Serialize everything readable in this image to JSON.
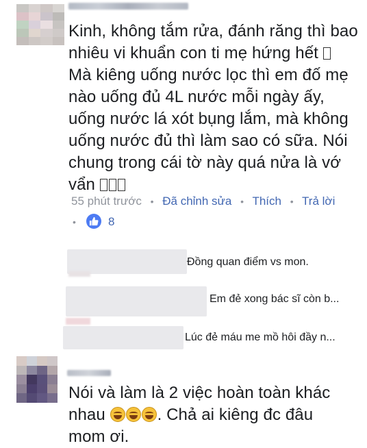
{
  "comment1": {
    "lines": [
      "Kinh, không tắm rửa, đánh răng thì bao",
      "nhiêu vi khuẩn con ti mẹ hứng hết",
      "Mà kiêng uống nước lọc thì em đố mẹ",
      "nào uống đủ 4L nước mỗi ngày ấy,",
      "uống nước lá xót bụng lắm, mà không",
      "uống nước đủ thì làm sao có sữa. Nói",
      "chung trong cái tờ này quá nửa là vớ",
      "vẩn"
    ],
    "time": "55 phút trước",
    "edited": "Đã chỉnh sửa",
    "like": "Thích",
    "reply": "Trả lời",
    "like_count": "8"
  },
  "replies": [
    {
      "text": "Đồng quan điểm vs mon."
    },
    {
      "text": "Em đẻ xong bác sĩ còn b..."
    },
    {
      "text": "Lúc đẻ máu me mồ hôi đầy n..."
    }
  ],
  "comment2": {
    "line1": "Nói và làm là 2 việc hoàn toàn khác",
    "line2_start": "nhau",
    "line2_end": ". Chả ai kiêng đc đâu",
    "line3": "mom ơi."
  },
  "colors": {
    "link": "#4267b2",
    "meta": "#90949c",
    "like_badge": "#4d7bf3",
    "reply_box": "#e9e9ec"
  },
  "icons": {
    "like": "thumbs-up-icon",
    "unsupported_emoji": "missing-glyph-box",
    "laugh": "tears-of-joy-emoji"
  }
}
